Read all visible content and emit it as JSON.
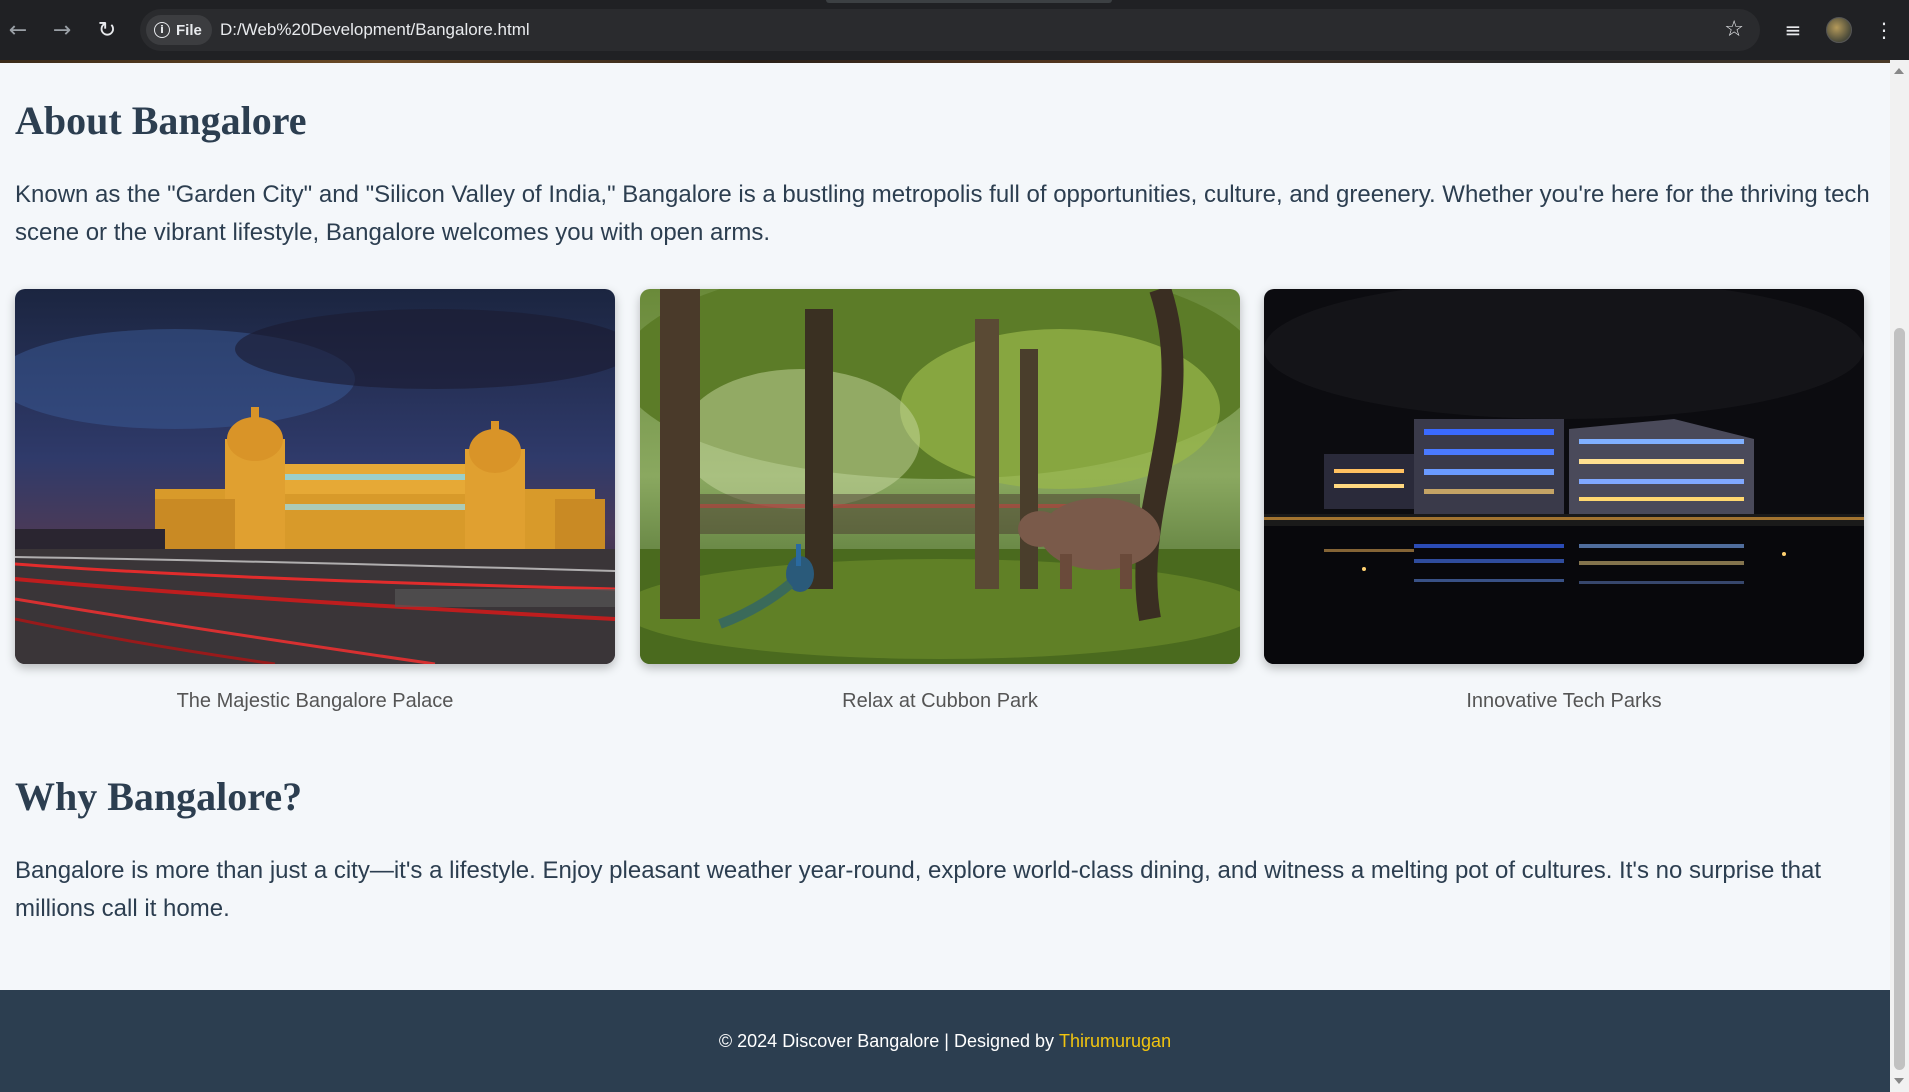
{
  "browser": {
    "site_label": "File",
    "url": "D:/Web%20Development/Bangalore.html",
    "icons": [
      "back-arrow-icon",
      "forward-arrow-icon",
      "reload-icon",
      "info-icon",
      "star-icon",
      "media-queue-icon",
      "avatar",
      "kebab-menu-icon"
    ]
  },
  "about": {
    "heading": "About Bangalore",
    "text": "Known as the \"Garden City\" and \"Silicon Valley of India,\" Bangalore is a bustling metropolis full of opportunities, culture, and greenery. Whether you're here for the thriving tech scene or the vibrant lifestyle, Bangalore welcomes you with open arms."
  },
  "gallery": [
    {
      "caption": "The Majestic Bangalore Palace"
    },
    {
      "caption": "Relax at Cubbon Park"
    },
    {
      "caption": "Innovative Tech Parks"
    }
  ],
  "why": {
    "heading": "Why Bangalore?",
    "text": "Bangalore is more than just a city—it's a lifestyle. Enjoy pleasant weather year-round, explore world-class dining, and witness a melting pot of cultures. It's no surprise that millions call it home."
  },
  "footer": {
    "text": "© 2024 Discover Bangalore | Designed by",
    "credit": "Thirumurugan"
  },
  "colors": {
    "heading": "#2c3e50",
    "footer_bg": "#2c3e50",
    "credit": "#f1c40f",
    "page_bg": "#f4f7fa"
  }
}
